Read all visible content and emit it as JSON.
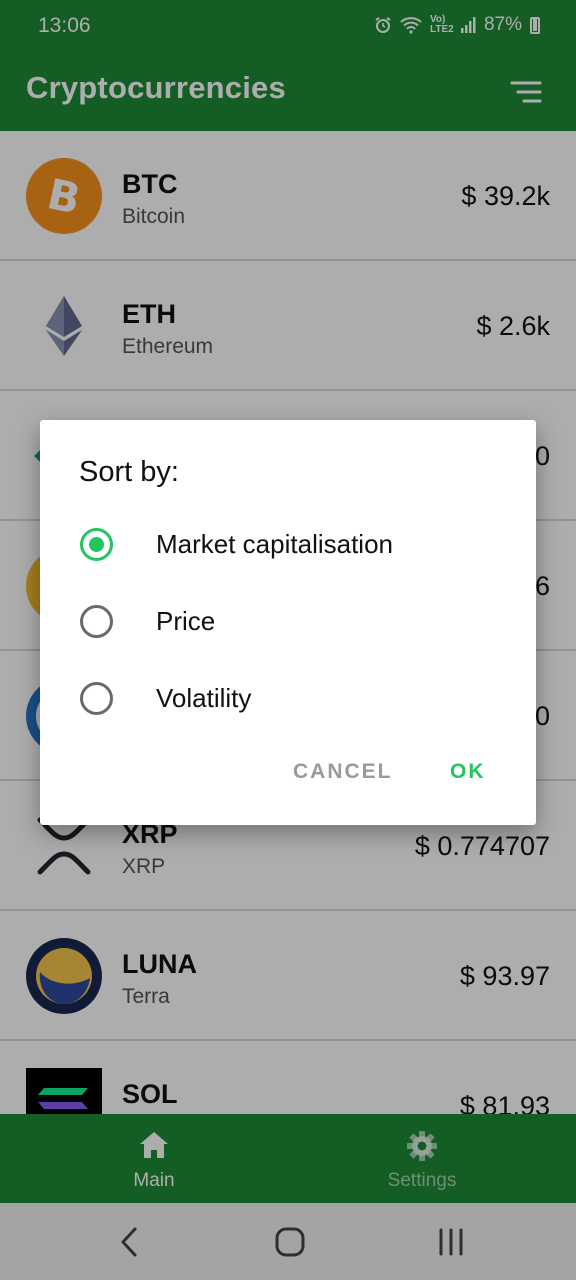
{
  "status_bar": {
    "time": "13:06",
    "network": "Vo) LTE2",
    "battery": "87%"
  },
  "app_bar": {
    "title": "Cryptocurrencies",
    "sort_icon": "sort-icon"
  },
  "coins": [
    {
      "symbol": "BTC",
      "name": "Bitcoin",
      "price": "$ 39.2k",
      "icon": "bitcoin-icon",
      "color": "#f7931a"
    },
    {
      "symbol": "ETH",
      "name": "Ethereum",
      "price": "$ 2.6k",
      "icon": "ethereum-icon",
      "color": "#62688f"
    },
    {
      "symbol": "",
      "name": "",
      "price": "0",
      "icon": "coin-3-icon",
      "color": "#1ba27a"
    },
    {
      "symbol": "",
      "name": "",
      "price": "6",
      "icon": "coin-4-icon",
      "color": "#f3ba2f"
    },
    {
      "symbol": "",
      "name": "",
      "price": "0",
      "icon": "coin-5-icon",
      "color": "#2775ca"
    },
    {
      "symbol": "XRP",
      "name": "XRP",
      "price": "$ 0.774707",
      "icon": "xrp-icon",
      "color": "#23292f"
    },
    {
      "symbol": "LUNA",
      "name": "Terra",
      "price": "$ 93.97",
      "icon": "luna-icon",
      "color": "#172852"
    },
    {
      "symbol": "SOL",
      "name": "",
      "price": "$ 81.93",
      "icon": "solana-icon",
      "color": "#000000"
    }
  ],
  "dialog": {
    "title": "Sort by:",
    "options": [
      {
        "label": "Market capitalisation",
        "selected": true
      },
      {
        "label": "Price",
        "selected": false
      },
      {
        "label": "Volatility",
        "selected": false
      }
    ],
    "cancel_label": "CANCEL",
    "ok_label": "OK"
  },
  "bottom_nav": {
    "items": [
      {
        "label": "Main",
        "icon": "home-icon",
        "active": true
      },
      {
        "label": "Settings",
        "icon": "gear-icon",
        "active": false
      }
    ]
  },
  "system_nav": {
    "back": "back-icon",
    "home": "home-circle-icon",
    "recents": "recents-icon"
  },
  "colors": {
    "primary": "#1e8a36",
    "accent": "#22c55e"
  }
}
